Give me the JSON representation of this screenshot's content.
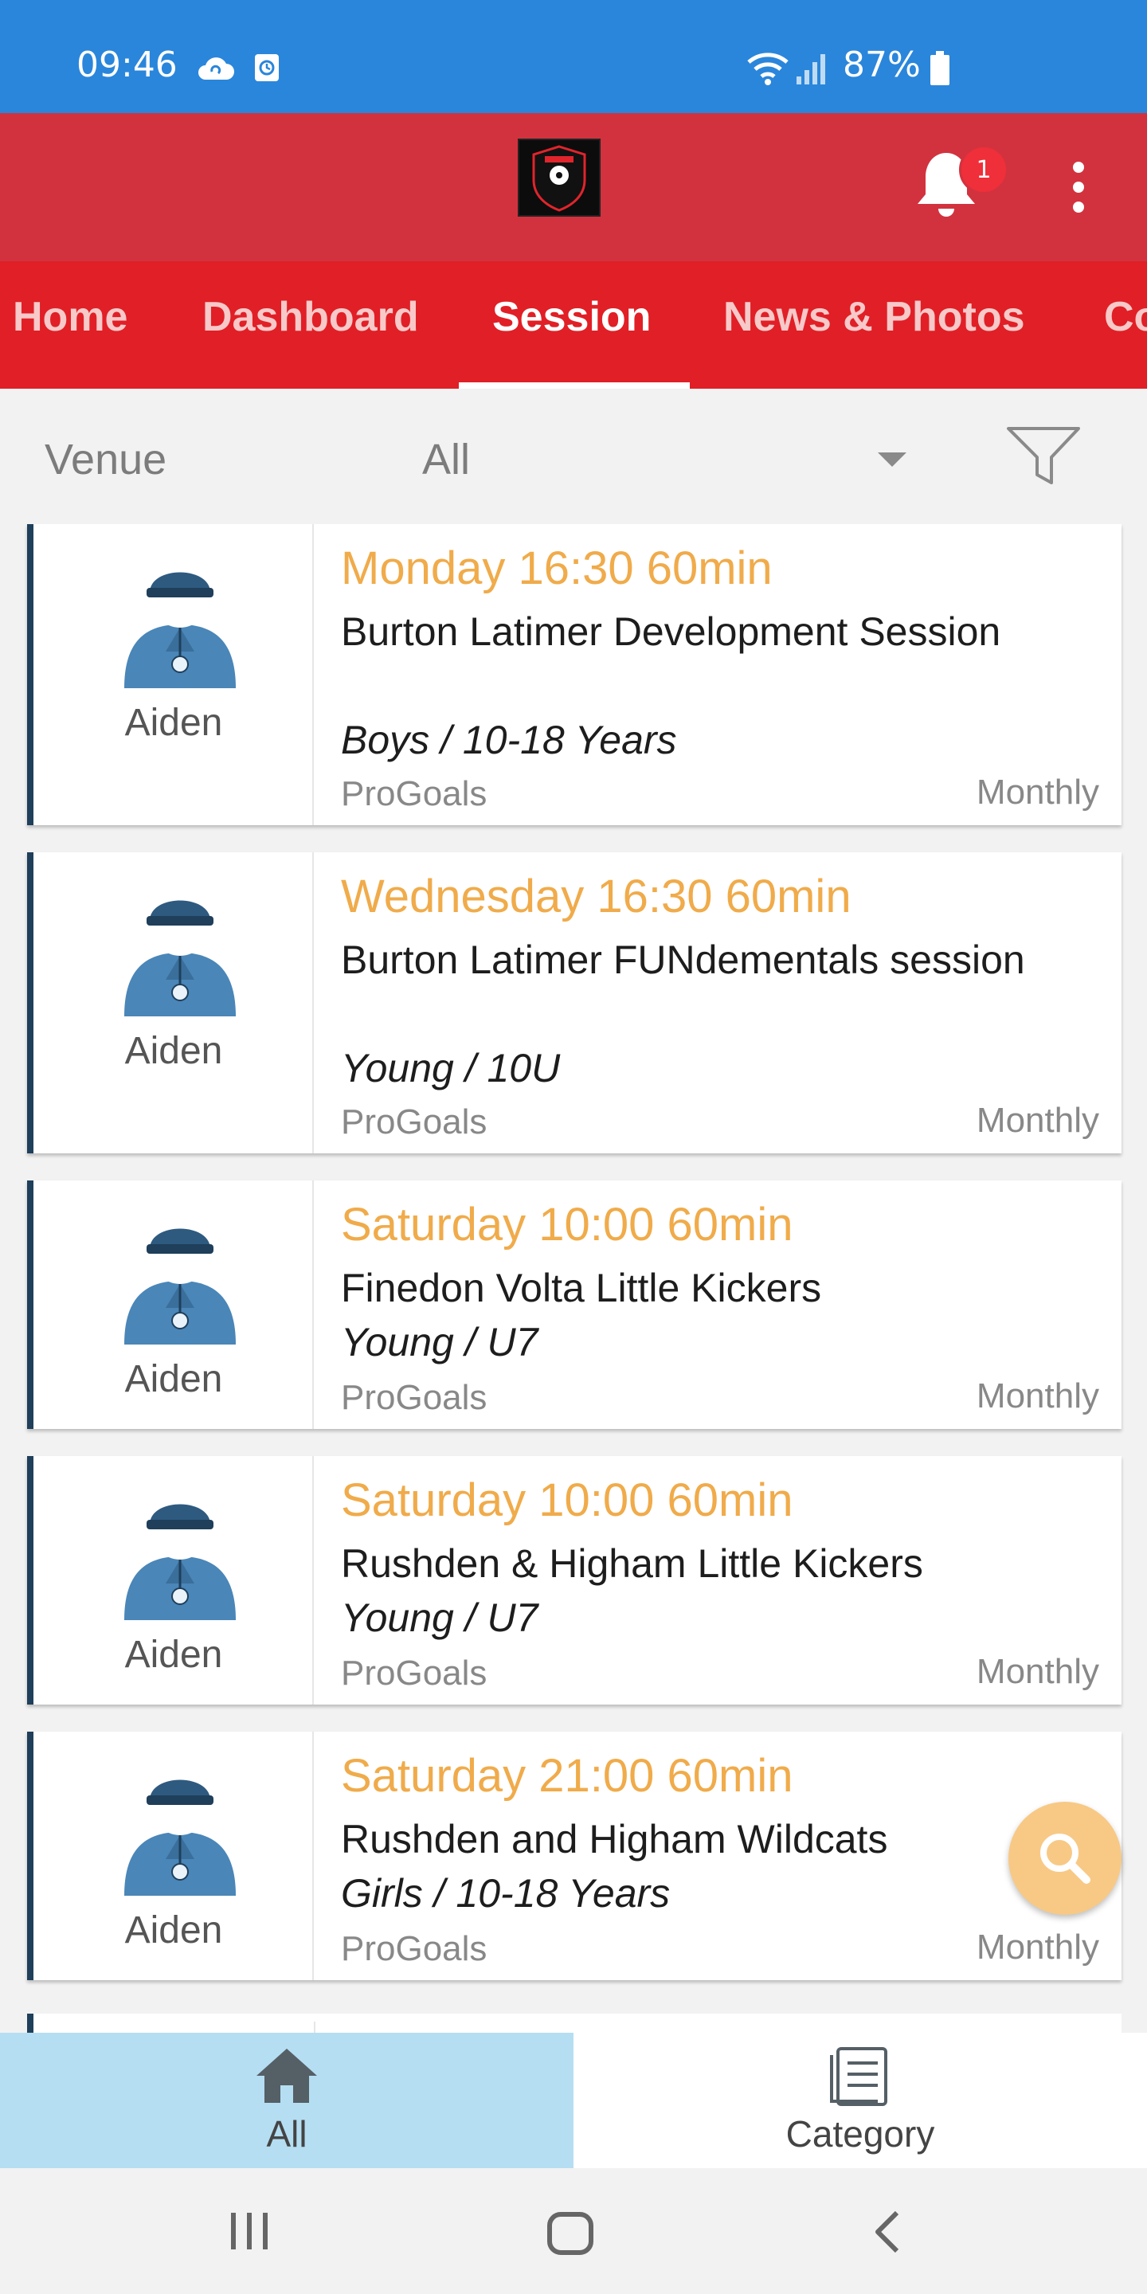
{
  "status_bar": {
    "time": "09:46",
    "battery": "87%",
    "icons": [
      "cloud-sync-icon",
      "screen-record-icon",
      "wifi-icon",
      "signal-icon",
      "battery-icon"
    ]
  },
  "header": {
    "logo_icon": "progoals-logo",
    "notification_count": "1",
    "colors": {
      "header": "#d2323e",
      "tabs": "#e11f26",
      "status": "#2a86db"
    }
  },
  "tabs": [
    {
      "label": "Home",
      "active": false
    },
    {
      "label": "Dashboard",
      "active": false
    },
    {
      "label": "Session",
      "active": true
    },
    {
      "label": "News & Photos",
      "active": false
    },
    {
      "label": "Co",
      "active": false
    }
  ],
  "filter": {
    "venue_label": "Venue",
    "venue_value": "All",
    "filter_icon": "filter-icon"
  },
  "sessions": [
    {
      "coach": "Aiden",
      "time": "Monday 16:30 60min",
      "title": "Burton Latimer Development Session",
      "category": "Boys / 10-18 Years",
      "org": "ProGoals",
      "frequency": "Monthly"
    },
    {
      "coach": "Aiden",
      "time": "Wednesday 16:30 60min",
      "title": "Burton Latimer FUNdementals session",
      "category": "Young / 10U",
      "org": "ProGoals",
      "frequency": "Monthly"
    },
    {
      "coach": "Aiden",
      "time": "Saturday 10:00 60min",
      "title": "Finedon Volta Little Kickers",
      "category": "Young / U7",
      "org": "ProGoals",
      "frequency": "Monthly"
    },
    {
      "coach": "Aiden",
      "time": "Saturday 10:00 60min",
      "title": "Rushden & Higham Little Kickers",
      "category": "Young / U7",
      "org": "ProGoals",
      "frequency": "Monthly"
    },
    {
      "coach": "Aiden",
      "time": "Saturday 21:00 60min",
      "title": "Rushden and Higham Wildcats",
      "category": "Girls / 10-18 Years",
      "org": "ProGoals",
      "frequency": "Monthly"
    }
  ],
  "bottom_nav": {
    "all_label": "All",
    "category_label": "Category"
  },
  "accent_color": "#f0ab4a"
}
